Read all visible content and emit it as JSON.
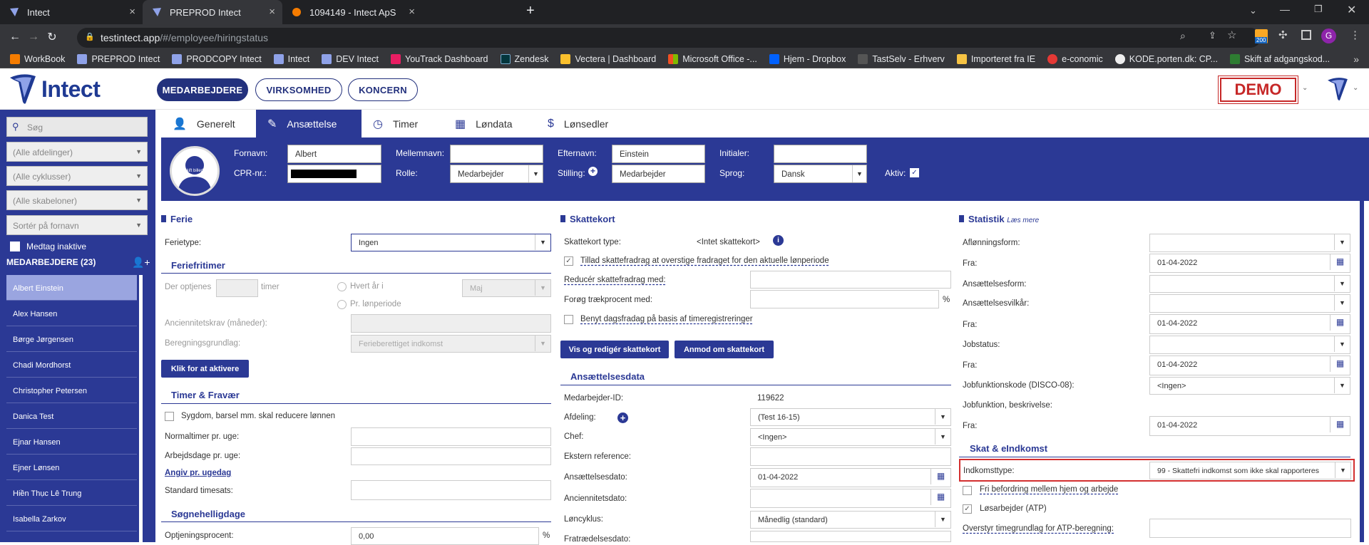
{
  "browser": {
    "tabs": [
      {
        "title": "Intect",
        "close": "×"
      },
      {
        "title": "PREPROD Intect",
        "close": "×"
      },
      {
        "title": "1094149 - Intect ApS",
        "close": "×"
      }
    ],
    "new_tab": "+",
    "url_host": "testintect.app",
    "url_path": "/#/employee/hiringstatus",
    "ext_badge": "200",
    "profile_initial": "G",
    "bookmarks": [
      "WorkBook",
      "PREPROD Intect",
      "PRODCOPY Intect",
      "Intect",
      "DEV Intect",
      "YouTrack Dashboard",
      "Zendesk",
      "Vectera | Dashboard",
      "Microsoft Office -...",
      "Hjem - Dropbox",
      "TastSelv - Erhverv",
      "Importeret fra IE",
      "e-conomic",
      "KODE.porten.dk: CP...",
      "Skift af adgangskod..."
    ]
  },
  "header": {
    "logo_text": "Intect",
    "nav": [
      "MEDARBEJDERE",
      "VIRKSOMHED",
      "KONCERN"
    ],
    "demo_badge": "DEMO"
  },
  "sidebar": {
    "search_placeholder": "Søg",
    "filters": [
      "(Alle afdelinger)",
      "(Alle cyklusser)",
      "(Alle skabeloner)",
      "Sortér på fornavn"
    ],
    "include_inactive": "Medtag inaktive",
    "employees_heading": "MEDARBEJDERE (23)",
    "employees": [
      "Albert Einstein",
      "Alex Hansen",
      "Børge Jørgensen",
      "Chadi Mordhorst",
      "Christopher Petersen",
      "Danica Test",
      "Ejnar Hansen",
      "Ejner Lønsen",
      "Hiền Thục Lê Trung",
      "Isabella Zarkov"
    ]
  },
  "tabs": [
    "Generelt",
    "Ansættelse",
    "Timer",
    "Løndata",
    "Lønsedler"
  ],
  "profile": {
    "avatar_text": "Skift billede",
    "labels": {
      "first": "Fornavn:",
      "middle": "Mellemnavn:",
      "last": "Efternavn:",
      "initials": "Initialer:",
      "cpr": "CPR-nr.:",
      "role": "Rolle:",
      "position": "Stilling:",
      "language": "Sprog:",
      "active": "Aktiv:"
    },
    "values": {
      "first": "Albert",
      "middle": "",
      "last": "Einstein",
      "initials": "",
      "cpr": "",
      "role": "Medarbejder",
      "position": "Medarbejder",
      "language": "Dansk"
    }
  },
  "col1": {
    "ferie_title": "Ferie",
    "ferietype_label": "Ferietype:",
    "ferietype_value": "Ingen",
    "feriefritimer_title": "Feriefritimer",
    "der_optjenes": "Der optjenes",
    "timer": "timer",
    "hvert_aar": "Hvert år i",
    "maj": "Maj",
    "pr_loenperiode": "Pr. lønperiode",
    "anciennitet_label": "Anciennitetskrav (måneder):",
    "beregning_label": "Beregningsgrundlag:",
    "beregning_value": "Ferieberettiget indkomst",
    "activate_button": "Klik for at aktivere",
    "timer_fravaer_title": "Timer & Fravær",
    "sygdom_label": "Sygdom, barsel mm. skal reducere lønnen",
    "normaltimer_label": "Normaltimer pr. uge:",
    "arbejdsdage_label": "Arbejdsdage pr. uge:",
    "angiv_link": "Angiv pr. ugedag",
    "timesats_label": "Standard timesats:",
    "soegnehelligdage_title": "Søgnehelligdage",
    "optjening_label": "Optjeningsprocent:",
    "optjening_value": "0,00",
    "percent": "%"
  },
  "col2": {
    "skattekort_title": "Skattekort",
    "type_label": "Skattekort type:",
    "type_value": "<Intet skattekort>",
    "tillad_label": "Tillad skattefradrag at overstige fradraget for den aktuelle lønperiode",
    "reducer_label": "Reducér skattefradrag med:",
    "foroeg_label": "Forøg trækprocent med:",
    "percent": "%",
    "benyt_label": "Benyt dagsfradag på basis af timeregistreringer",
    "vis_button": "Vis og redigér skattekort",
    "anmod_button": "Anmod om skattekort",
    "ansaettelsesdata_title": "Ansættelsesdata",
    "medarbejder_id_label": "Medarbejder-ID:",
    "medarbejder_id_value": "119622",
    "afdeling_label": "Afdeling:",
    "afdeling_value": "(Test 16-15)",
    "chef_label": "Chef:",
    "chef_value": "<Ingen>",
    "ekstern_label": "Ekstern reference:",
    "ansaettelsesdato_label": "Ansættelsesdato:",
    "ansaettelsesdato_value": "01-04-2022",
    "anciennitetsdato_label": "Anciennitetsdato:",
    "loencyklus_label": "Løncyklus:",
    "loencyklus_value": "Månedlig (standard)",
    "fratraedelse_label": "Fratrædelsesdato:"
  },
  "col3": {
    "statistik_title": "Statistik",
    "laes_mere": "Læs mere",
    "afloenningsform_label": "Aflønningsform:",
    "fra_label": "Fra:",
    "date_value": "01-04-2022",
    "ansaettelsesform_label": "Ansættelsesform:",
    "ansaettelsesvilkaar_label": "Ansættelsesvilkår:",
    "jobstatus_label": "Jobstatus:",
    "jobfunktionskode_label": "Jobfunktionskode (DISCO-08):",
    "jobfunktionskode_value": "<Ingen>",
    "jobfunktion_beskrivelse_label": "Jobfunktion, beskrivelse:",
    "skat_title": "Skat & eIndkomst",
    "indkomsttype_label": "Indkomsttype:",
    "indkomsttype_value": "99 - Skattefri indkomst som ikke skal rapporteres",
    "fri_befordring_label": "Fri befordring mellem hjem og arbejde",
    "loesarbejder_label": "Løsarbejder (ATP)",
    "overstyr_label": "Overstyr timegrundlag for ATP-beregning:"
  }
}
